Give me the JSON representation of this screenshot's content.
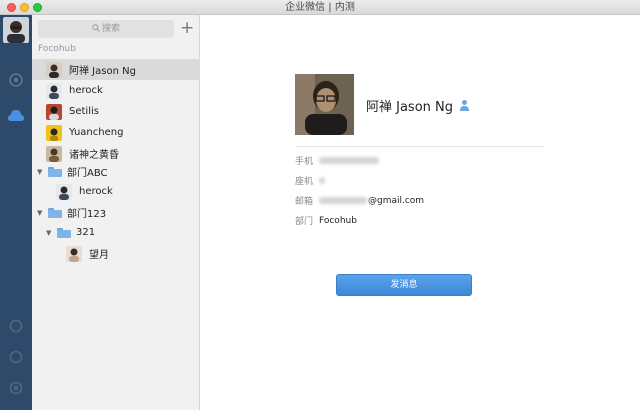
{
  "window": {
    "title": "企业微信 | 内测"
  },
  "search": {
    "placeholder": "搜索"
  },
  "contacts": {
    "group_label": "Focohub",
    "members": [
      {
        "name": "阿禅 Jason Ng",
        "selected": true
      },
      {
        "name": "herock"
      },
      {
        "name": "Setilis"
      },
      {
        "name": "Yuancheng"
      },
      {
        "name": "诸神之黄昏"
      }
    ],
    "departments": [
      {
        "name": "部门ABC",
        "members": [
          {
            "name": "herock"
          }
        ]
      },
      {
        "name": "部门123",
        "subdepartments": [
          {
            "name": "321",
            "members": [
              {
                "name": "望月"
              }
            ]
          }
        ]
      }
    ]
  },
  "detail": {
    "name": "阿禅 Jason Ng",
    "fields": {
      "phone_label": "手机",
      "landline_label": "座机",
      "email_label": "邮箱",
      "email_value": "@gmail.com",
      "department_label": "部门",
      "department_value": "Focohub"
    },
    "send_button": "发消息"
  },
  "colors": {
    "rail": "#2e4a6b",
    "accent": "#4a90e2",
    "folder": "#7fb4e8"
  }
}
